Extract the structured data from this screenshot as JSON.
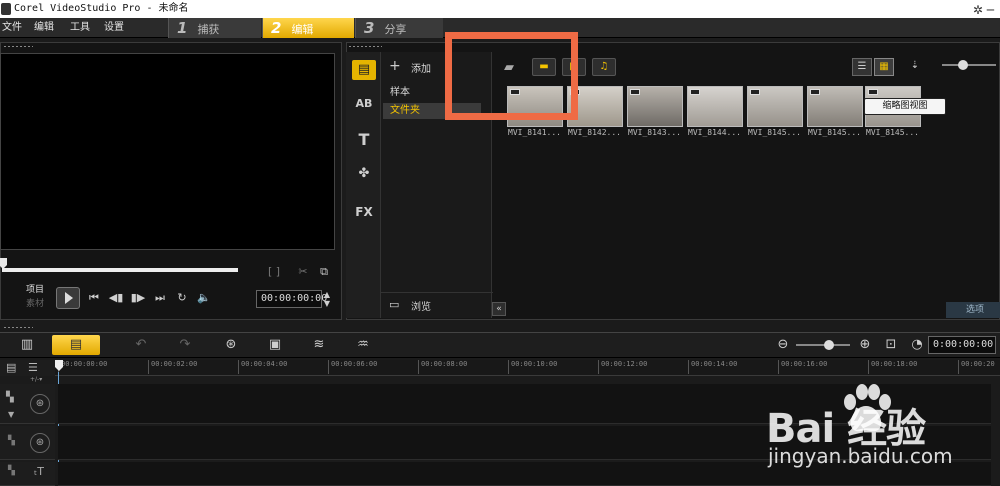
{
  "window": {
    "title": "Corel VideoStudio Pro - 未命名"
  },
  "menu": [
    "文件",
    "编辑",
    "工具",
    "设置"
  ],
  "steps": [
    {
      "num": "1",
      "label": "捕获"
    },
    {
      "num": "2",
      "label": "编辑"
    },
    {
      "num": "3",
      "label": "分享"
    }
  ],
  "player": {
    "mode_project": "项目",
    "mode_clip": "素材",
    "timecode": "00:00:00:00"
  },
  "library": {
    "add_label": "添加",
    "folders": [
      "样本",
      "文件夹"
    ],
    "selected_folder": "文件夹",
    "browse_label": "浏览",
    "options_label": "选项",
    "thumbnails": [
      {
        "label": "MVI_8141..."
      },
      {
        "label": "MVI_8142..."
      },
      {
        "label": "MVI_8143..."
      },
      {
        "label": "MVI_8144..."
      },
      {
        "label": "MVI_8145..."
      },
      {
        "label": "MVI_8145..."
      },
      {
        "label": "MVI_8145..."
      }
    ],
    "tooltip": "缩略图视图"
  },
  "timeline": {
    "timecode": "0:00:00:00",
    "ruler": [
      "00:00:00:00",
      "00:00:02:00",
      "00:00:04:00",
      "00:00:06:00",
      "00:00:08:00",
      "00:00:10:00",
      "00:00:12:00",
      "00:00:14:00",
      "00:00:16:00",
      "00:00:18:00",
      "00:00:20"
    ]
  },
  "watermark": {
    "brand": "Bai  经验",
    "url": "jingyan.baidu.com"
  },
  "colors": {
    "accent": "#f3c300",
    "highlight": "#ef6b45"
  }
}
